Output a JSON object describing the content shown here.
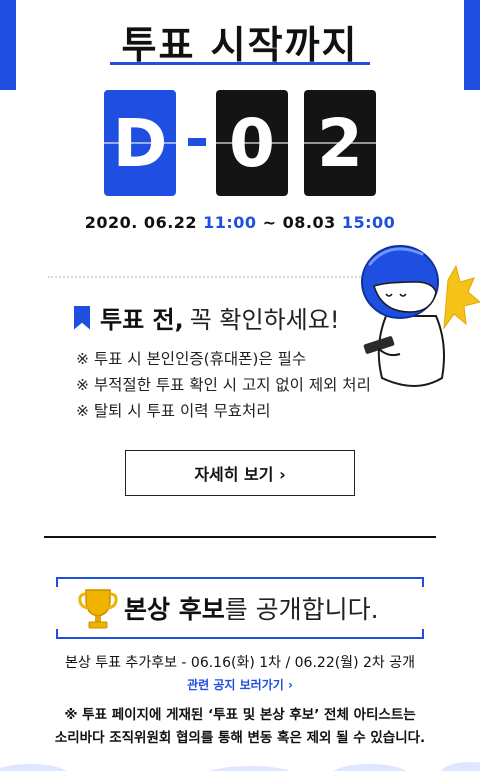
{
  "title": "투표 시작까지",
  "countdown": {
    "d": "D",
    "digit1": "0",
    "digit2": "2"
  },
  "period": {
    "start_date": "2020. 06.22",
    "start_time": "11:00",
    "sep": "~",
    "end_date": "08.03",
    "end_time": "15:00"
  },
  "notice": {
    "heading_bold": "투표 전,",
    "heading_normal": "꼭 확인하세요!",
    "items": [
      "※ 투표 시 본인인증(휴대폰)은 필수",
      "※ 부적절한 투표 확인 시 고지 없이 제외 처리",
      "※ 탈퇴 시 투표 이력 무효처리"
    ]
  },
  "detail_button": "자세히 보기 ›",
  "nominee": {
    "heading_bold": "본상 후보",
    "heading_normal": "를 공개합니다.",
    "schedule": "본상 투표 추가후보 - 06.16(화) 1차 / 06.22(월) 2차 공개",
    "related_link": "관련 공지 보러가기 ›",
    "disclaimer_line1": "※ 투표 페이지에 게재된 ‘투표 및 본상 후보’ 전체 아티스트는",
    "disclaimer_line2": "소리바다 조직위원회 협의를 통해 변동 혹은 제외 될 수 있습니다."
  },
  "colors": {
    "accent": "#1e4fe0",
    "tile_dark": "#141414",
    "gold": "#f0b400"
  },
  "icons": {
    "trophy": "trophy-icon",
    "bookmark": "bookmark-icon",
    "mascot": "mascot-character"
  }
}
